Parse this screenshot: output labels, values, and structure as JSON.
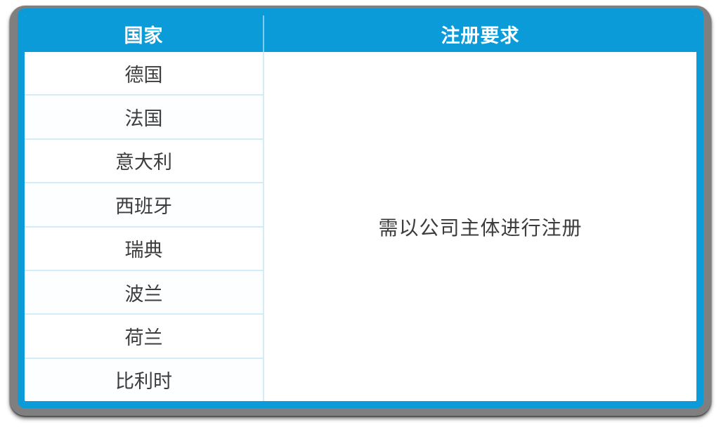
{
  "table": {
    "headers": {
      "country": "国家",
      "requirement": "注册要求"
    },
    "rows": [
      {
        "country": "德国"
      },
      {
        "country": "法国"
      },
      {
        "country": "意大利"
      },
      {
        "country": "西班牙"
      },
      {
        "country": "瑞典"
      },
      {
        "country": "波兰"
      },
      {
        "country": "荷兰"
      },
      {
        "country": "比利时"
      }
    ],
    "requirement_value": "需以公司主体进行注册",
    "colors": {
      "header_background": "#0b9bd8",
      "header_text": "#ffffff",
      "border_accent": "#0b9bd8",
      "grid_line": "#d4ecf7",
      "frame": "#7f7f7f",
      "body_text": "#3c3c3c",
      "cell_background": "#ffffff"
    }
  }
}
